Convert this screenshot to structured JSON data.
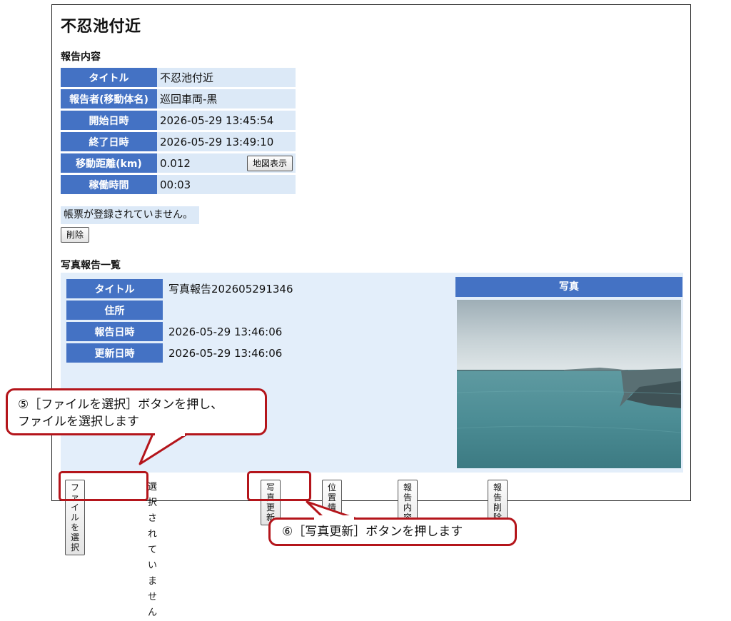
{
  "page": {
    "title": "不忍池付近"
  },
  "report": {
    "section_title": "報告内容",
    "rows": [
      {
        "label": "タイトル",
        "value": "不忍池付近"
      },
      {
        "label": "報告者(移動体名)",
        "value": "巡回車両-黒"
      },
      {
        "label": "開始日時",
        "value": "2026-05-29 13:45:54"
      },
      {
        "label": "終了日時",
        "value": "2026-05-29 13:49:10"
      },
      {
        "label": "移動距離(km)",
        "value": "0.012"
      },
      {
        "label": "稼働時間",
        "value": "00:03"
      }
    ],
    "map_button": "地図表示",
    "notice": "帳票が登録されていません。",
    "delete_button": "削除"
  },
  "photos": {
    "section_title": "写真報告一覧",
    "rows": [
      {
        "label": "タイトル",
        "value": "写真報告202605291346"
      },
      {
        "label": "住所",
        "value": ""
      },
      {
        "label": "報告日時",
        "value": "2026-05-29 13:46:06"
      },
      {
        "label": "更新日時",
        "value": "2026-05-29 13:46:06"
      }
    ],
    "photo_header": "写真",
    "choose_file_button": "ファイルを選択",
    "no_file_text": "選択されていません",
    "update_photo_button": "写真更新",
    "edit_location_button": "位置情報編集",
    "edit_content_button": "報告内容編集",
    "delete_report_button": "報告削除"
  },
  "callouts": {
    "step5_line1": "⑤［ファイルを選択］ボタンを押し、",
    "step5_line2": "ファイルを選択します",
    "step6": "⑥［写真更新］ボタンを押します"
  },
  "colors": {
    "header_blue": "#4472c4",
    "cell_light_blue": "#dce9f7",
    "callout_red": "#b4151b"
  }
}
